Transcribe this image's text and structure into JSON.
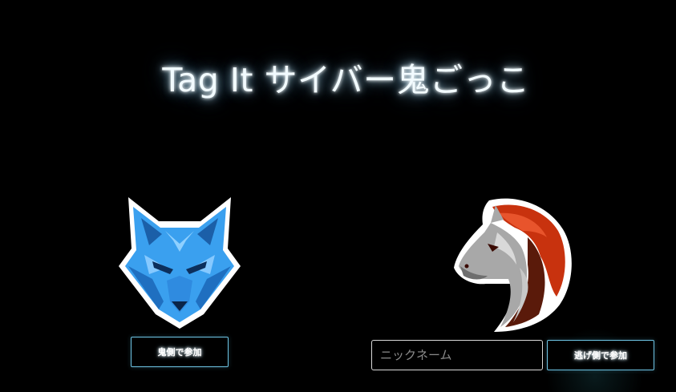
{
  "header": {
    "title": "Tag It サイバー鬼ごっこ"
  },
  "oni_side": {
    "logo_icon": "wolf-head-icon",
    "join_button_label": "鬼側で参加"
  },
  "runner_side": {
    "logo_icon": "horse-head-icon",
    "nickname_placeholder": "ニックネーム",
    "nickname_value": "",
    "join_button_label": "逃げ側で参加"
  },
  "colors": {
    "background": "#000000",
    "button_border": "#6fc6e6",
    "wolf_blue": "#3aa0ef",
    "horse_red": "#c8320e"
  }
}
